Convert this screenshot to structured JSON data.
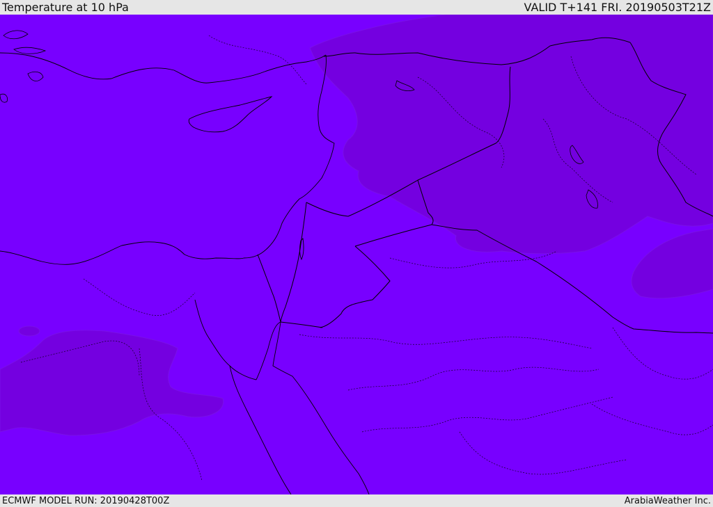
{
  "header": {
    "title": "Temperature at 10 hPa",
    "valid": "VALID T+141 FRI. 20190503T21Z"
  },
  "footer": {
    "model_run": "ECMWF MODEL RUN: 20190428T00Z",
    "credit": "ArabiaWeather Inc."
  },
  "colors": {
    "field_base": "#7800ff",
    "field_cold": "#7400e0",
    "coastline": "#000000",
    "frame": "#e6e6e6"
  }
}
